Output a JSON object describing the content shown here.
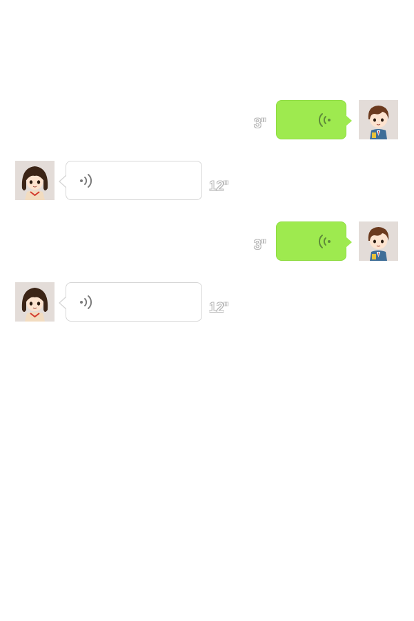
{
  "messages": [
    {
      "direction": "outgoing",
      "sender": "boy",
      "duration": "3\"",
      "type": "voice"
    },
    {
      "direction": "incoming",
      "sender": "girl",
      "duration": "12\"",
      "type": "voice"
    },
    {
      "direction": "outgoing",
      "sender": "boy",
      "duration": "3\"",
      "type": "voice"
    },
    {
      "direction": "incoming",
      "sender": "girl",
      "duration": "12\"",
      "type": "voice"
    }
  ],
  "colors": {
    "outgoing_bubble": "#9eea4f",
    "incoming_bubble": "#ffffff",
    "incoming_border": "#d6d6d6",
    "avatar_bg": "#e3dcd8"
  },
  "icons": {
    "voice": "sound-wave-icon",
    "boy_avatar": "boy-avatar",
    "girl_avatar": "girl-avatar"
  }
}
